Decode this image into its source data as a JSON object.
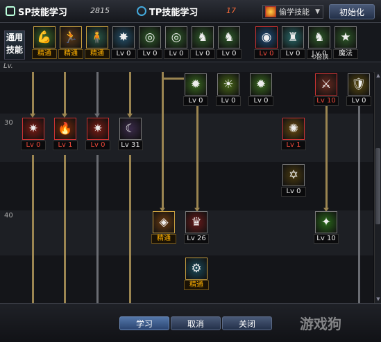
{
  "header": {
    "sp_tab_label": "SP技能学习",
    "sp_points": "2815",
    "tp_tab_label": "TP技能学习",
    "tp_points": "17",
    "steal_dropdown_label": "偷学技能",
    "reset_button_label": "初始化"
  },
  "common_skills": {
    "label_line1": "通用",
    "label_line2": "技能",
    "items": [
      {
        "label": "精通",
        "style": "gold",
        "icon": "💪"
      },
      {
        "label": "精通",
        "style": "gold",
        "icon": "🏃"
      },
      {
        "label": "精通",
        "style": "gold",
        "icon": "🧍"
      },
      {
        "label": "Lv 0",
        "style": "normal",
        "icon": "✸"
      },
      {
        "label": "Lv 0",
        "style": "normal",
        "icon": "◎"
      },
      {
        "label": "Lv 0",
        "style": "normal",
        "icon": "◎"
      },
      {
        "label": "Lv 0",
        "style": "normal",
        "icon": "♞"
      },
      {
        "label": "Lv 0",
        "style": "normal",
        "icon": "♞"
      },
      {
        "label": "Lv 0",
        "style": "red",
        "icon": "◉"
      },
      {
        "label": "Lv 0",
        "style": "normal",
        "icon": "♜"
      },
      {
        "label": "Lv 0",
        "style": "normal",
        "icon": "♞"
      },
      {
        "label": "魔法",
        "style": "normal",
        "icon": "★"
      }
    ],
    "swap_label": "⟲替换"
  },
  "tree": {
    "level_header": "Lv.",
    "row_labels": [
      "30",
      "40"
    ],
    "skills": [
      {
        "label": "Lv 0",
        "style": "normal",
        "icon": "✹"
      },
      {
        "label": "Lv 0",
        "style": "normal",
        "icon": "☀"
      },
      {
        "label": "Lv 0",
        "style": "normal",
        "icon": "✹"
      },
      {
        "label": "Lv 10",
        "style": "red",
        "icon": "⚔"
      },
      {
        "label": "Lv 0",
        "style": "normal",
        "icon": "🛡"
      },
      {
        "label": "Lv 0",
        "style": "red",
        "icon": "✷"
      },
      {
        "label": "Lv 1",
        "style": "red",
        "icon": "🔥"
      },
      {
        "label": "Lv 0",
        "style": "red",
        "icon": "✷"
      },
      {
        "label": "Lv 31",
        "style": "normal",
        "icon": "☾"
      },
      {
        "label": "Lv 1",
        "style": "red",
        "icon": "✺"
      },
      {
        "label": "Lv 0",
        "style": "normal",
        "icon": "✡"
      },
      {
        "label": "精通",
        "style": "gold",
        "icon": "◈"
      },
      {
        "label": "Lv 26",
        "style": "normal",
        "icon": "♛"
      },
      {
        "label": "Lv 10",
        "style": "normal",
        "icon": "✦"
      },
      {
        "label": "精通",
        "style": "gold",
        "icon": "⚙"
      }
    ]
  },
  "footer": {
    "learn_button": "学习",
    "cancel_button": "取消",
    "close_button": "关闭",
    "watermark": "游戏狗"
  },
  "colors": {
    "accent": "#9b8551",
    "level_red": "#f04a3a",
    "mastery_gold": "#ffb000"
  }
}
